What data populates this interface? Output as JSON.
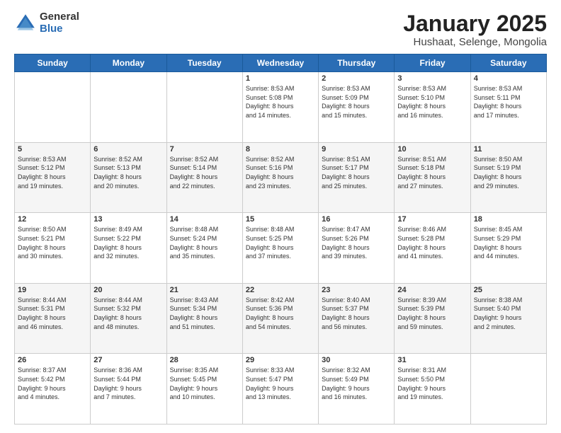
{
  "logo": {
    "general": "General",
    "blue": "Blue"
  },
  "header": {
    "title": "January 2025",
    "subtitle": "Hushaat, Selenge, Mongolia"
  },
  "days_header": [
    "Sunday",
    "Monday",
    "Tuesday",
    "Wednesday",
    "Thursday",
    "Friday",
    "Saturday"
  ],
  "weeks": [
    [
      {
        "day": "",
        "info": ""
      },
      {
        "day": "",
        "info": ""
      },
      {
        "day": "",
        "info": ""
      },
      {
        "day": "1",
        "info": "Sunrise: 8:53 AM\nSunset: 5:08 PM\nDaylight: 8 hours\nand 14 minutes."
      },
      {
        "day": "2",
        "info": "Sunrise: 8:53 AM\nSunset: 5:09 PM\nDaylight: 8 hours\nand 15 minutes."
      },
      {
        "day": "3",
        "info": "Sunrise: 8:53 AM\nSunset: 5:10 PM\nDaylight: 8 hours\nand 16 minutes."
      },
      {
        "day": "4",
        "info": "Sunrise: 8:53 AM\nSunset: 5:11 PM\nDaylight: 8 hours\nand 17 minutes."
      }
    ],
    [
      {
        "day": "5",
        "info": "Sunrise: 8:53 AM\nSunset: 5:12 PM\nDaylight: 8 hours\nand 19 minutes."
      },
      {
        "day": "6",
        "info": "Sunrise: 8:52 AM\nSunset: 5:13 PM\nDaylight: 8 hours\nand 20 minutes."
      },
      {
        "day": "7",
        "info": "Sunrise: 8:52 AM\nSunset: 5:14 PM\nDaylight: 8 hours\nand 22 minutes."
      },
      {
        "day": "8",
        "info": "Sunrise: 8:52 AM\nSunset: 5:16 PM\nDaylight: 8 hours\nand 23 minutes."
      },
      {
        "day": "9",
        "info": "Sunrise: 8:51 AM\nSunset: 5:17 PM\nDaylight: 8 hours\nand 25 minutes."
      },
      {
        "day": "10",
        "info": "Sunrise: 8:51 AM\nSunset: 5:18 PM\nDaylight: 8 hours\nand 27 minutes."
      },
      {
        "day": "11",
        "info": "Sunrise: 8:50 AM\nSunset: 5:19 PM\nDaylight: 8 hours\nand 29 minutes."
      }
    ],
    [
      {
        "day": "12",
        "info": "Sunrise: 8:50 AM\nSunset: 5:21 PM\nDaylight: 8 hours\nand 30 minutes."
      },
      {
        "day": "13",
        "info": "Sunrise: 8:49 AM\nSunset: 5:22 PM\nDaylight: 8 hours\nand 32 minutes."
      },
      {
        "day": "14",
        "info": "Sunrise: 8:48 AM\nSunset: 5:24 PM\nDaylight: 8 hours\nand 35 minutes."
      },
      {
        "day": "15",
        "info": "Sunrise: 8:48 AM\nSunset: 5:25 PM\nDaylight: 8 hours\nand 37 minutes."
      },
      {
        "day": "16",
        "info": "Sunrise: 8:47 AM\nSunset: 5:26 PM\nDaylight: 8 hours\nand 39 minutes."
      },
      {
        "day": "17",
        "info": "Sunrise: 8:46 AM\nSunset: 5:28 PM\nDaylight: 8 hours\nand 41 minutes."
      },
      {
        "day": "18",
        "info": "Sunrise: 8:45 AM\nSunset: 5:29 PM\nDaylight: 8 hours\nand 44 minutes."
      }
    ],
    [
      {
        "day": "19",
        "info": "Sunrise: 8:44 AM\nSunset: 5:31 PM\nDaylight: 8 hours\nand 46 minutes."
      },
      {
        "day": "20",
        "info": "Sunrise: 8:44 AM\nSunset: 5:32 PM\nDaylight: 8 hours\nand 48 minutes."
      },
      {
        "day": "21",
        "info": "Sunrise: 8:43 AM\nSunset: 5:34 PM\nDaylight: 8 hours\nand 51 minutes."
      },
      {
        "day": "22",
        "info": "Sunrise: 8:42 AM\nSunset: 5:36 PM\nDaylight: 8 hours\nand 54 minutes."
      },
      {
        "day": "23",
        "info": "Sunrise: 8:40 AM\nSunset: 5:37 PM\nDaylight: 8 hours\nand 56 minutes."
      },
      {
        "day": "24",
        "info": "Sunrise: 8:39 AM\nSunset: 5:39 PM\nDaylight: 8 hours\nand 59 minutes."
      },
      {
        "day": "25",
        "info": "Sunrise: 8:38 AM\nSunset: 5:40 PM\nDaylight: 9 hours\nand 2 minutes."
      }
    ],
    [
      {
        "day": "26",
        "info": "Sunrise: 8:37 AM\nSunset: 5:42 PM\nDaylight: 9 hours\nand 4 minutes."
      },
      {
        "day": "27",
        "info": "Sunrise: 8:36 AM\nSunset: 5:44 PM\nDaylight: 9 hours\nand 7 minutes."
      },
      {
        "day": "28",
        "info": "Sunrise: 8:35 AM\nSunset: 5:45 PM\nDaylight: 9 hours\nand 10 minutes."
      },
      {
        "day": "29",
        "info": "Sunrise: 8:33 AM\nSunset: 5:47 PM\nDaylight: 9 hours\nand 13 minutes."
      },
      {
        "day": "30",
        "info": "Sunrise: 8:32 AM\nSunset: 5:49 PM\nDaylight: 9 hours\nand 16 minutes."
      },
      {
        "day": "31",
        "info": "Sunrise: 8:31 AM\nSunset: 5:50 PM\nDaylight: 9 hours\nand 19 minutes."
      },
      {
        "day": "",
        "info": ""
      }
    ]
  ]
}
